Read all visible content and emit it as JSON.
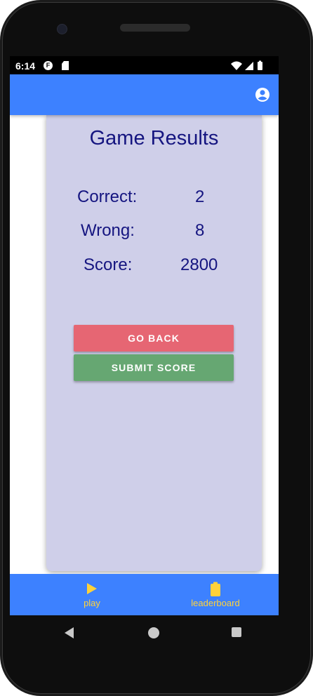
{
  "status_bar": {
    "time": "6:14",
    "icons": [
      "notification-f-icon",
      "sd-card-icon",
      "wifi-icon",
      "signal-icon",
      "battery-icon"
    ]
  },
  "app_bar": {
    "color": "#3d81ff",
    "icon": "account-circle-icon"
  },
  "results": {
    "title": "Game Results",
    "stats": [
      {
        "label": "Correct:",
        "value": "2"
      },
      {
        "label": "Wrong:",
        "value": "8"
      },
      {
        "label": "Score:",
        "value": "2800"
      }
    ],
    "buttons": {
      "go_back": "GO BACK",
      "submit_score": "SUBMIT SCORE"
    }
  },
  "bottom_nav": {
    "items": [
      {
        "label": "play",
        "icon": "play-icon"
      },
      {
        "label": "leaderboard",
        "icon": "clipboard-icon"
      }
    ],
    "accent": "#ffd23a"
  },
  "system_nav": {
    "icons": [
      "back-icon",
      "home-icon",
      "recents-icon"
    ]
  }
}
